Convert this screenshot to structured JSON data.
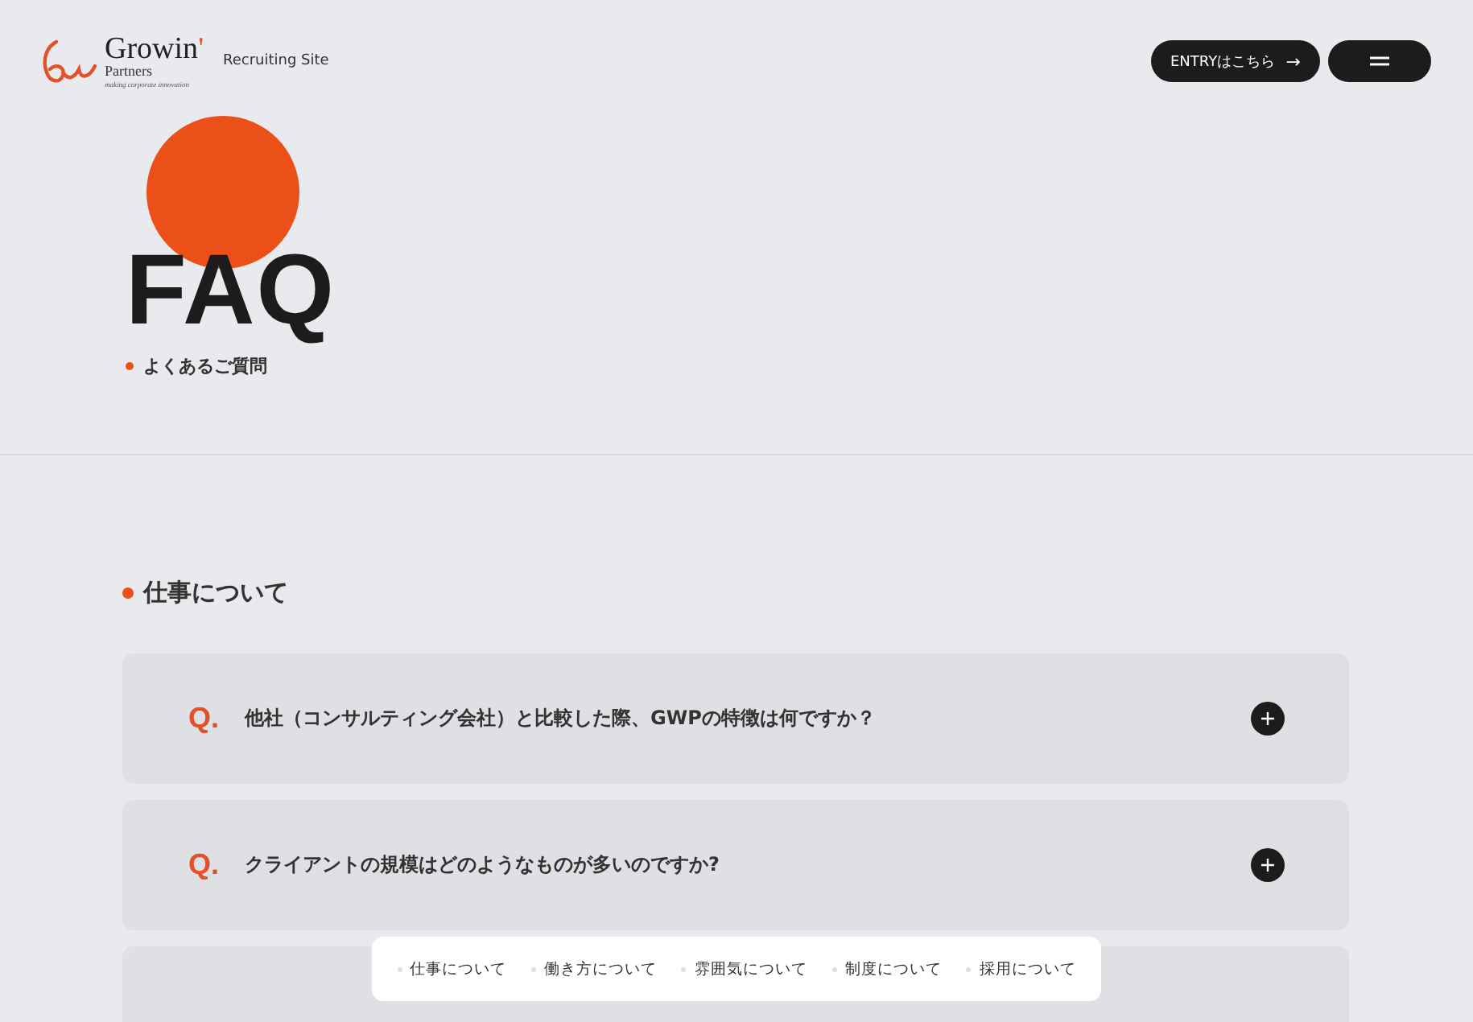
{
  "header": {
    "logo": {
      "name": "Growin",
      "mark": "'",
      "sub": "Partners",
      "tagline": "making corporate innovation"
    },
    "site_label": "Recruiting Site",
    "entry_button": "ENTRYはこちら",
    "arrow": "→"
  },
  "hero": {
    "title": "FAQ",
    "subtitle": "よくあるご質問"
  },
  "section": {
    "title": "仕事について",
    "questions": [
      {
        "marker": "Q.",
        "text": "他社（コンサルティング会社）と比較した際、GWPの特徴は何ですか？"
      },
      {
        "marker": "Q.",
        "text": "クライアントの規模はどのようなものが多いのですか?"
      }
    ]
  },
  "floating_nav": [
    "仕事について",
    "働き方について",
    "雰囲気について",
    "制度について",
    "採用について"
  ]
}
